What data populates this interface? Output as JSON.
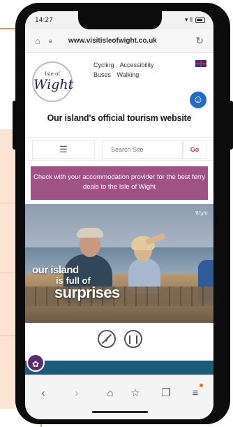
{
  "status_bar": {
    "time": "14:27",
    "signal": "▾ ll"
  },
  "browser": {
    "url": "www.visitisleofwight.co.uk",
    "home_icon": "home-icon",
    "reload_icon": "reload-icon"
  },
  "site": {
    "logo_small": "Isle of",
    "logo_big": "Wight",
    "nav_links": [
      "Cycling",
      "Accessibility",
      "Buses",
      "Walking"
    ],
    "tagline": "Our island's official tourism website",
    "search_placeholder": "Search Site",
    "go_label": "Go",
    "menu_icon": "☰"
  },
  "promo": {
    "text": "Check with your accommodation provider for the best ferry deals to the Isle of Wight"
  },
  "hero": {
    "logo": "Wight",
    "line1": "our island",
    "line2": "is full of",
    "line3": "surprises"
  },
  "media_controls": {
    "mute_icon": "mute-icon",
    "pause_icon": "pause-icon"
  },
  "bottom_bar": {
    "back": "‹",
    "forward": "›",
    "home": "⌂",
    "favorite": "☆",
    "tabs": "❐",
    "menu": "≡"
  },
  "colors": {
    "promo": "#9f5285",
    "accent": "#c9344f",
    "a11y": "#1e6ec8",
    "footer": "#1d5b7a"
  }
}
